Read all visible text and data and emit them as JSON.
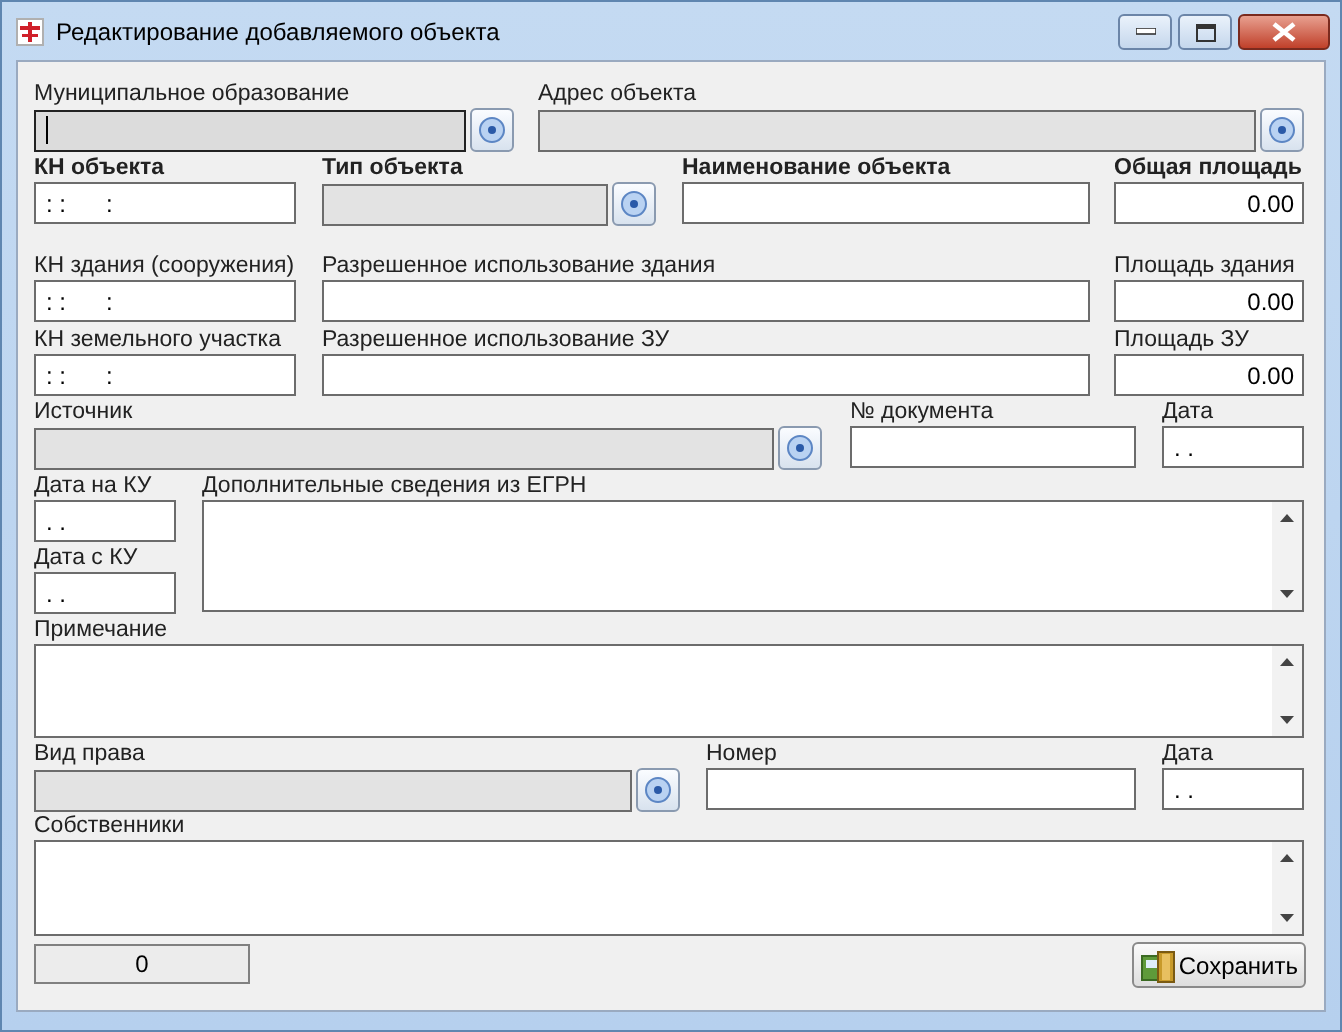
{
  "window": {
    "title": "Редактирование добавляемого объекта"
  },
  "rows": [
    {
      "fields": [
        {
          "kind": "lookup",
          "label": "Муниципальное образование",
          "bold": false,
          "focused": true
        },
        {
          "kind": "lookup",
          "label": "Адрес объекта",
          "bold": false,
          "focused": false
        }
      ]
    },
    {
      "fields": [
        {
          "kind": "text",
          "label": "КН объекта",
          "bold": true,
          "value": ": :      :"
        },
        {
          "kind": "lookup",
          "label": "Тип объекта",
          "bold": true,
          "focused": false
        },
        {
          "kind": "text",
          "label": "Наименование объекта",
          "bold": true
        },
        {
          "kind": "number",
          "label": "Общая площадь",
          "bold": true,
          "value": "0.00"
        }
      ]
    },
    {
      "fields": [
        {
          "kind": "text",
          "label": "КН здания (сооружения)",
          "bold": false,
          "value": ": :      :"
        },
        {
          "kind": "text",
          "label": "Разрешенное использование здания",
          "bold": false
        },
        {
          "kind": "number",
          "label": "Площадь здания",
          "bold": false,
          "value": "0.00"
        }
      ]
    },
    {
      "fields": [
        {
          "kind": "text",
          "label": "КН земельного участка",
          "bold": false,
          "value": ": :      :"
        },
        {
          "kind": "text",
          "label": "Разрешенное использование ЗУ",
          "bold": false
        },
        {
          "kind": "number",
          "label": "Площадь ЗУ",
          "bold": false,
          "value": "0.00"
        }
      ]
    },
    {
      "fields": [
        {
          "kind": "lookup",
          "label": "Источник",
          "bold": false,
          "focused": false
        },
        {
          "kind": "text",
          "label": "№ документа",
          "bold": false
        },
        {
          "kind": "text",
          "label": "Дата",
          "bold": false,
          "value": ". ."
        }
      ]
    },
    {
      "kind": "split",
      "fields": [
        {
          "kind": "text",
          "label": "Дата на КУ",
          "bold": false,
          "value": ". ."
        },
        {
          "kind": "text",
          "label": "Дата с КУ",
          "bold": false,
          "value": ". ."
        },
        {
          "kind": "memo",
          "label": "Дополнительные сведения из ЕГРН",
          "bold": false
        }
      ]
    },
    {
      "fields": [
        {
          "kind": "memo",
          "label": "Примечание",
          "bold": false
        }
      ]
    },
    {
      "fields": [
        {
          "kind": "lookup",
          "label": "Вид права",
          "bold": false,
          "focused": false
        },
        {
          "kind": "text",
          "label": "Номер",
          "bold": false
        },
        {
          "kind": "text",
          "label": "Дата",
          "bold": false,
          "value": ". ."
        }
      ]
    },
    {
      "fields": [
        {
          "kind": "memo",
          "label": "Собственники",
          "bold": false
        }
      ]
    }
  ],
  "counter": "0",
  "save_button": {
    "label": "Сохранить"
  }
}
